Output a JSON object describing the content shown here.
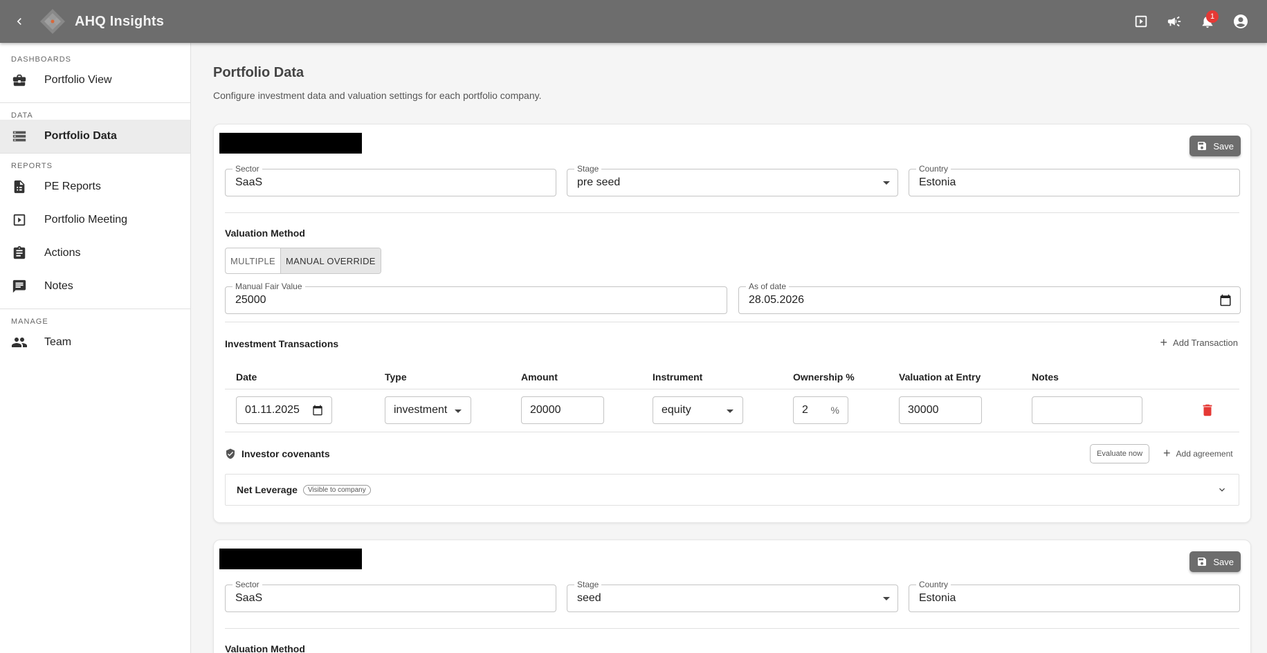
{
  "app": {
    "title": "AHQ Insights",
    "notification_count": "1"
  },
  "sidebar": {
    "sections": [
      {
        "title": "DASHBOARDS",
        "items": [
          {
            "label": "Portfolio View",
            "icon": "briefcase-icon"
          }
        ]
      },
      {
        "title": "DATA",
        "items": [
          {
            "label": "Portfolio Data",
            "icon": "storage-icon",
            "active": true
          }
        ]
      },
      {
        "title": "REPORTS",
        "items": [
          {
            "label": "PE Reports",
            "icon": "report-icon"
          },
          {
            "label": "Portfolio Meeting",
            "icon": "slideshow-icon"
          },
          {
            "label": "Actions",
            "icon": "assignment-icon"
          },
          {
            "label": "Notes",
            "icon": "comment-icon"
          }
        ]
      },
      {
        "title": "MANAGE",
        "items": [
          {
            "label": "Team",
            "icon": "people-icon"
          }
        ]
      }
    ]
  },
  "main": {
    "title": "Portfolio Data",
    "subtitle": "Configure investment data and valuation settings for each portfolio company."
  },
  "labels": {
    "save": "Save",
    "sector": "Sector",
    "stage": "Stage",
    "country": "Country",
    "valuation_method": "Valuation Method",
    "method_multiple": "MULTIPLE",
    "method_manual": "MANUAL OVERRIDE",
    "manual_fair_value": "Manual Fair Value",
    "as_of_date": "As of date",
    "investment_transactions": "Investment Transactions",
    "add_transaction": "Add Transaction",
    "col_date": "Date",
    "col_type": "Type",
    "col_amount": "Amount",
    "col_instrument": "Instrument",
    "col_ownership": "Ownership %",
    "col_valuation": "Valuation at Entry",
    "col_notes": "Notes",
    "percent": "%",
    "investor_covenants": "Investor covenants",
    "evaluate_now": "Evaluate now",
    "add_agreement": "Add agreement",
    "visible_chip": "Visible to company"
  },
  "companies": [
    {
      "sector": "SaaS",
      "stage": "pre seed",
      "country": "Estonia",
      "selected_method": "MANUAL OVERRIDE",
      "manual_fair_value": "25000",
      "as_of_date": "28.05.2026",
      "transactions": [
        {
          "date": "01.11.2025",
          "type": "investment",
          "amount": "20000",
          "instrument": "equity",
          "ownership": "2",
          "valuation": "30000",
          "notes": ""
        }
      ],
      "covenants": [
        {
          "name": "Net Leverage"
        }
      ]
    },
    {
      "sector": "SaaS",
      "stage": "seed",
      "country": "Estonia"
    }
  ]
}
